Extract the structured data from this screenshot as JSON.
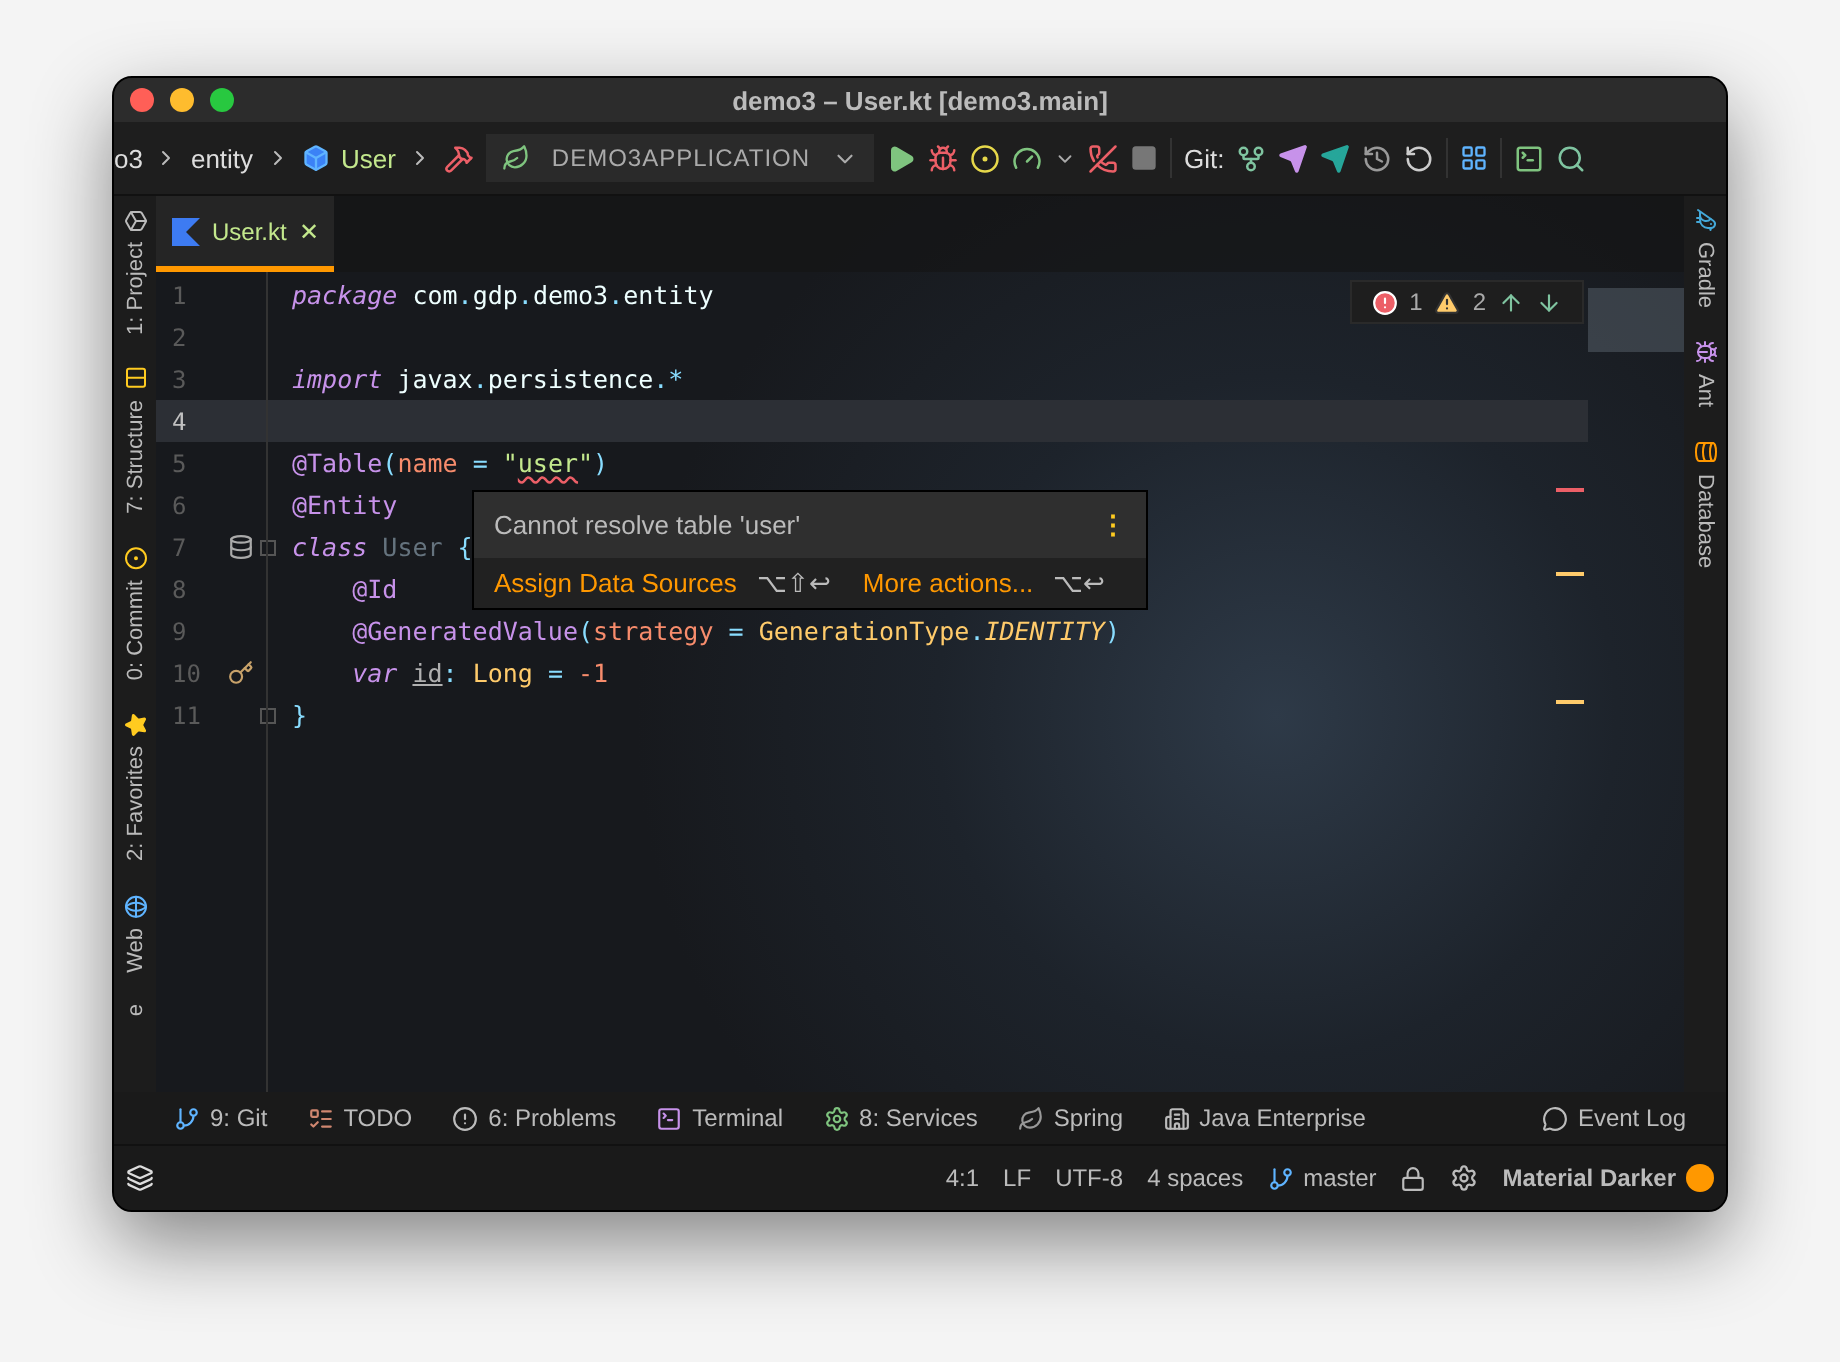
{
  "window": {
    "title": "demo3 – User.kt [demo3.main]"
  },
  "navbar": {
    "breadcrumbs": [
      {
        "label": "o3",
        "kind": "folder"
      },
      {
        "label": "entity",
        "kind": "folder"
      },
      {
        "label": "User",
        "kind": "class"
      }
    ],
    "run_config": "DEMO3APPLICATION",
    "git_label": "Git:"
  },
  "left_stripe": [
    {
      "label": "1: Project",
      "kind": "maven"
    },
    {
      "label": "7: Structure",
      "kind": "structure"
    },
    {
      "label": "0: Commit",
      "kind": "commit"
    },
    {
      "label": "2: Favorites",
      "kind": "star"
    },
    {
      "label": "Web",
      "kind": "globe"
    },
    {
      "label": "e",
      "kind": "plain"
    }
  ],
  "right_stripe": [
    {
      "label": "Gradle",
      "kind": "gradle"
    },
    {
      "label": "Ant",
      "kind": "ant"
    },
    {
      "label": "Database",
      "kind": "database"
    }
  ],
  "tabs": [
    {
      "label": "User.kt",
      "close": "✕",
      "selected": true
    }
  ],
  "inspections": {
    "errors": "1",
    "warnings": "2"
  },
  "code": [
    {
      "number": "1",
      "current": false,
      "tokens": [
        {
          "text": "package",
          "kind": "keyword"
        },
        {
          "text": " com",
          "kind": "plain"
        },
        {
          "text": ".",
          "kind": "punct"
        },
        {
          "text": "gdp",
          "kind": "plain"
        },
        {
          "text": ".",
          "kind": "punct"
        },
        {
          "text": "demo3",
          "kind": "plain"
        },
        {
          "text": ".",
          "kind": "punct"
        },
        {
          "text": "entity",
          "kind": "plain"
        }
      ]
    },
    {
      "number": "2",
      "current": false
    },
    {
      "number": "3",
      "current": false,
      "tokens": [
        {
          "text": "import",
          "kind": "keyword"
        },
        {
          "text": " javax",
          "kind": "plain"
        },
        {
          "text": ".",
          "kind": "punct"
        },
        {
          "text": "persistence",
          "kind": "plain"
        },
        {
          "text": ".*",
          "kind": "punct"
        }
      ]
    },
    {
      "number": "4",
      "current": true
    },
    {
      "number": "5",
      "current": false,
      "tokens": [
        {
          "text": "@Table",
          "kind": "annotation"
        },
        {
          "text": "(",
          "kind": "punct"
        },
        {
          "text": "name",
          "kind": "param"
        },
        {
          "text": " = ",
          "kind": "punct"
        },
        {
          "text": "\"",
          "kind": "string"
        },
        {
          "text": "user",
          "kind": "string-error"
        },
        {
          "text": "\"",
          "kind": "string"
        },
        {
          "text": ")",
          "kind": "punct"
        }
      ]
    },
    {
      "number": "6",
      "current": false,
      "tokens": [
        {
          "text": "@Entity",
          "kind": "annotation"
        }
      ]
    },
    {
      "number": "7",
      "current": false,
      "tokens": [
        {
          "text": "class",
          "kind": "keyword"
        },
        {
          "text": " User",
          "kind": "unused"
        },
        {
          "text": " {",
          "kind": "punct"
        }
      ]
    },
    {
      "number": "8",
      "current": false,
      "tokens": [
        {
          "text": "    @Id",
          "kind": "annotation"
        }
      ]
    },
    {
      "number": "9",
      "current": false,
      "tokens": [
        {
          "text": "    @GeneratedValue",
          "kind": "annotation"
        },
        {
          "text": "(",
          "kind": "punct"
        },
        {
          "text": "strategy",
          "kind": "param"
        },
        {
          "text": " = ",
          "kind": "punct"
        },
        {
          "text": "GenerationType",
          "kind": "type"
        },
        {
          "text": ".",
          "kind": "punct"
        },
        {
          "text": "IDENTITY",
          "kind": "constant"
        },
        {
          "text": ")",
          "kind": "punct"
        }
      ]
    },
    {
      "number": "10",
      "current": false,
      "tokens": [
        {
          "text": "    var ",
          "kind": "keyword"
        },
        {
          "text": "id",
          "kind": "property"
        },
        {
          "text": ": ",
          "kind": "punct"
        },
        {
          "text": "Long",
          "kind": "type"
        },
        {
          "text": " = ",
          "kind": "punct"
        },
        {
          "text": "-1",
          "kind": "number"
        }
      ]
    },
    {
      "number": "11",
      "current": false,
      "tokens": [
        {
          "text": "}",
          "kind": "punct"
        }
      ]
    }
  ],
  "popup": {
    "message": "Cannot resolve table 'user'",
    "menu_glyph": "⋮",
    "actions": [
      {
        "label": "Assign Data Sources",
        "shortcut": "⌥⇧↩"
      },
      {
        "label": "More actions...",
        "shortcut": "⌥↩"
      }
    ]
  },
  "stripe_marks": [
    {
      "color": "#ec5f67"
    },
    {
      "color": "#ffcb6b"
    },
    {
      "color": "#ffcb6b"
    }
  ],
  "tool_windows": [
    {
      "label": "9: Git",
      "kind": "branch"
    },
    {
      "label": "TODO",
      "kind": "todo"
    },
    {
      "label": "6: Problems",
      "kind": "problems"
    },
    {
      "label": "Terminal",
      "kind": "terminal"
    },
    {
      "label": "8: Services",
      "kind": "gear"
    },
    {
      "label": "Spring",
      "kind": "leaf"
    },
    {
      "label": "Java Enterprise",
      "kind": "enterprise"
    }
  ],
  "event_log": "Event Log",
  "status_bar": {
    "items": [
      "4:1",
      "LF",
      "UTF-8",
      "4 spaces"
    ],
    "branch": "master",
    "theme": "Material Darker"
  }
}
